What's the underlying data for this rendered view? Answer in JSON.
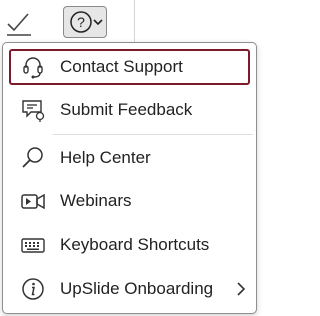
{
  "toolbar": {
    "help_label": "?"
  },
  "menu": {
    "items": [
      {
        "label": "Contact Support",
        "icon": "headset-icon",
        "selected": true
      },
      {
        "label": "Submit Feedback",
        "icon": "feedback-icon"
      },
      {
        "label": "Help Center",
        "icon": "search-icon"
      },
      {
        "label": "Webinars",
        "icon": "video-camera-icon"
      },
      {
        "label": "Keyboard Shortcuts",
        "icon": "keyboard-icon"
      },
      {
        "label": "UpSlide Onboarding",
        "icon": "info-icon",
        "has_submenu": true
      }
    ]
  },
  "colors": {
    "selected_border": "#7d1a2a",
    "text": "#222222",
    "icon": "#333333"
  }
}
